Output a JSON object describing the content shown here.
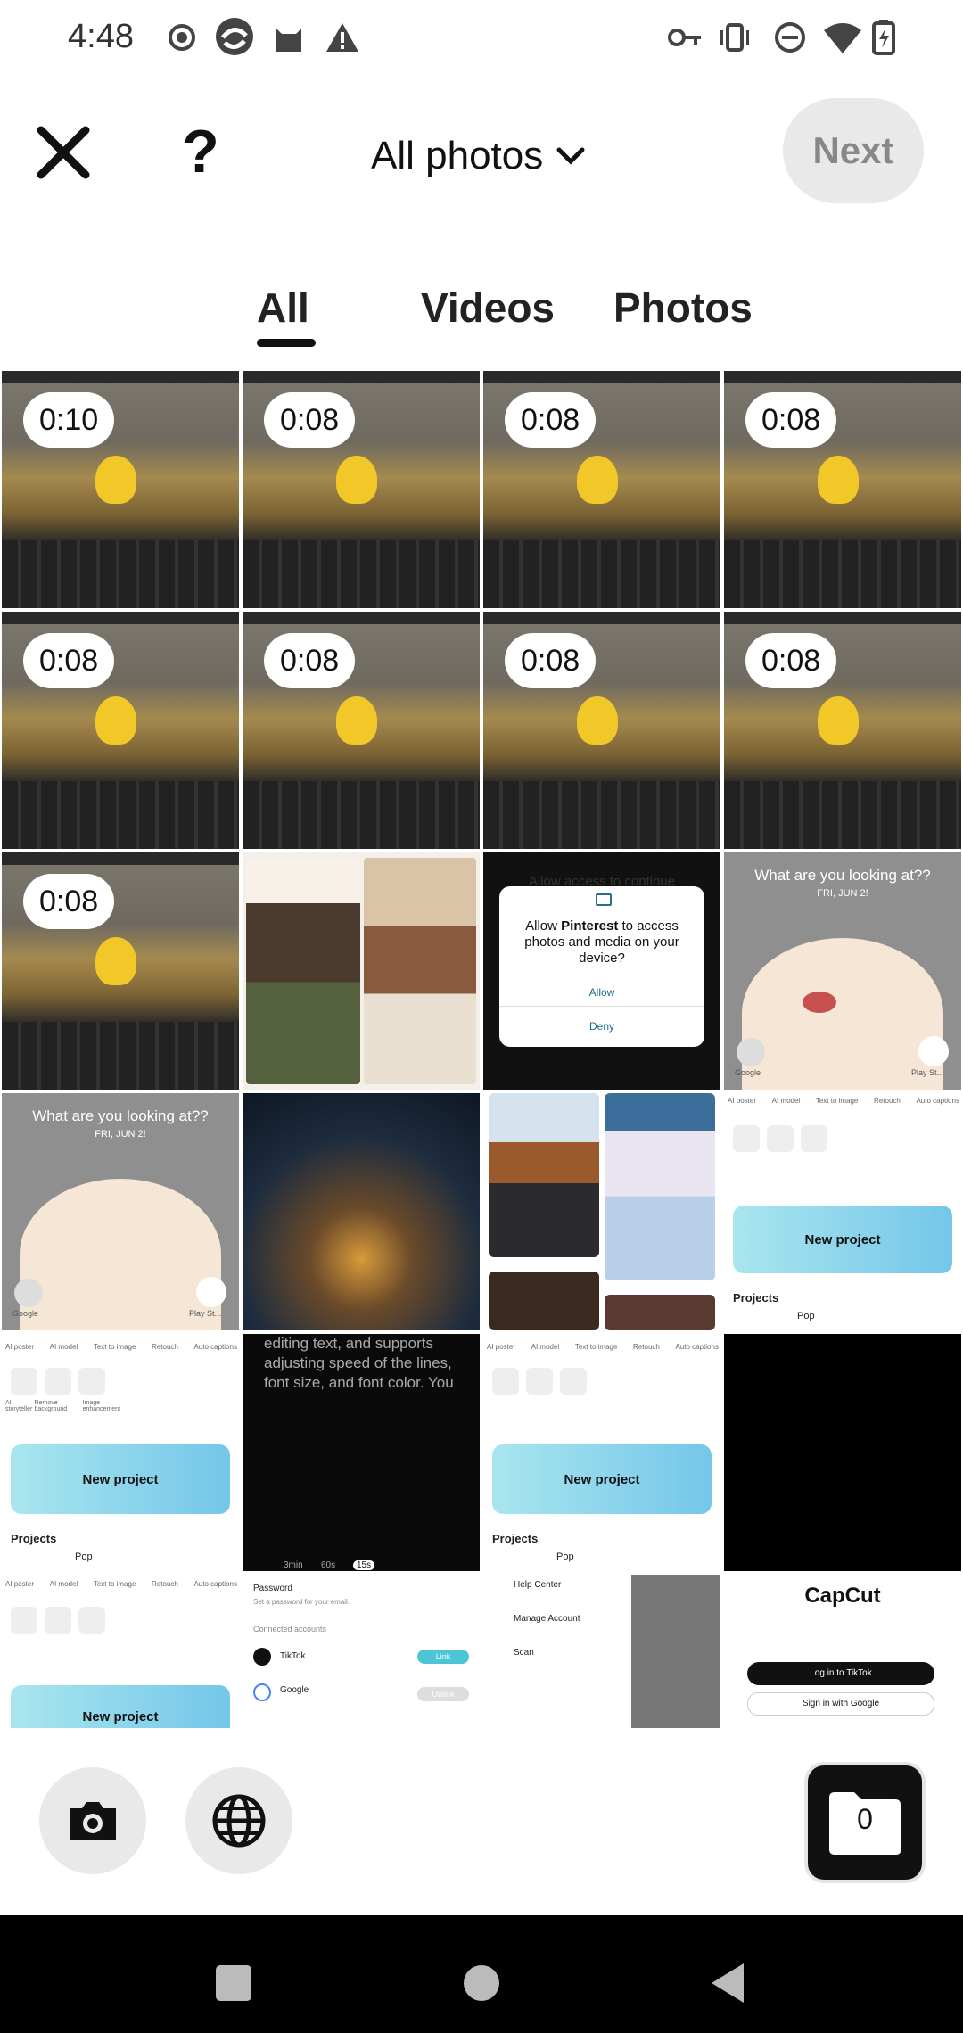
{
  "status_bar": {
    "time": "4:48"
  },
  "header": {
    "album": "All photos",
    "next_label": "Next",
    "help_label": "?"
  },
  "tabs": [
    {
      "label": "All"
    },
    {
      "label": "Videos"
    },
    {
      "label": "Photos"
    }
  ],
  "grid": {
    "video_durations": [
      "0:10",
      "0:08",
      "0:08",
      "0:08",
      "0:08",
      "0:08",
      "0:08",
      "0:08",
      "0:08"
    ],
    "dialog": {
      "faded_title": "Allow access to continue",
      "question_prefix": "Allow ",
      "question_app": "Pinterest",
      "question_suffix": " to access photos and media on your device?",
      "allow": "Allow",
      "deny": "Deny"
    },
    "lockscreen": {
      "message": "What are you looking at??",
      "date": "FRI, JUN 2!",
      "google_label": "Google",
      "play_label": "Play St..."
    },
    "capcut": {
      "new_project": "New project",
      "projects": "Projects",
      "project_name": "Pop",
      "top_labels": [
        "AI poster",
        "AI model",
        "Text to image",
        "Retouch",
        "Auto captions"
      ],
      "tool_labels": [
        "AI storyteller",
        "Remove background",
        "Image enhancement"
      ]
    },
    "dark_text": "editing text, and supports adjusting speed of the lines, font size, and font color. You",
    "dark_durations": [
      "3min",
      "60s",
      "15s"
    ],
    "account": {
      "password": "Password",
      "password_sub": "Set a password for your email.",
      "connected": "Connected accounts",
      "tiktok": "TikTok",
      "google": "Google",
      "link": "Link",
      "unlink": "Unlink"
    },
    "settings": {
      "help": "Help Center",
      "manage": "Manage Account",
      "scan": "Scan"
    },
    "login": {
      "logo": "CapCut",
      "tiktok_btn": "Log in to TikTok",
      "google_btn": "Sign in with Google"
    }
  },
  "bottom": {
    "selected_count": "0"
  },
  "colors": {
    "pill_bg": "#e9e9e9",
    "accent": "#111111"
  }
}
